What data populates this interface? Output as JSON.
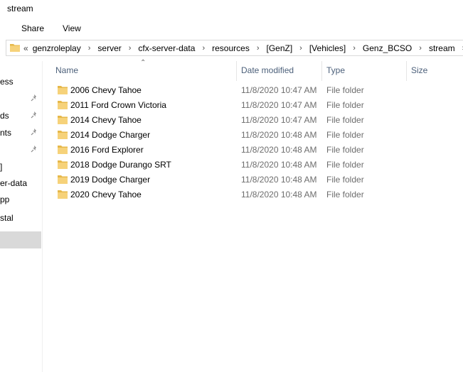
{
  "window": {
    "title": "stream"
  },
  "ribbon": {
    "tabs": [
      "Share",
      "View"
    ]
  },
  "address": {
    "overflow": "«",
    "crumbs": [
      "genzroleplay",
      "server",
      "cfx-server-data",
      "resources",
      "[GenZ]",
      "[Vehicles]",
      "Genz_BCSO",
      "stream"
    ]
  },
  "nav": {
    "items": [
      "ess",
      "ds",
      "nts",
      "]",
      "er-data",
      "pp",
      "stal"
    ]
  },
  "columns": {
    "name": "Name",
    "date": "Date modified",
    "type": "Type",
    "size": "Size"
  },
  "files": [
    {
      "name": "2006 Chevy Tahoe",
      "date": "11/8/2020 10:47 AM",
      "type": "File folder"
    },
    {
      "name": "2011 Ford Crown Victoria",
      "date": "11/8/2020 10:47 AM",
      "type": "File folder"
    },
    {
      "name": "2014 Chevy Tahoe",
      "date": "11/8/2020 10:47 AM",
      "type": "File folder"
    },
    {
      "name": "2014 Dodge Charger",
      "date": "11/8/2020 10:48 AM",
      "type": "File folder"
    },
    {
      "name": "2016 Ford Explorer",
      "date": "11/8/2020 10:48 AM",
      "type": "File folder"
    },
    {
      "name": "2018 Dodge Durango SRT",
      "date": "11/8/2020 10:48 AM",
      "type": "File folder"
    },
    {
      "name": "2019 Dodge Charger",
      "date": "11/8/2020 10:48 AM",
      "type": "File folder"
    },
    {
      "name": "2020 Chevy Tahoe",
      "date": "11/8/2020 10:48 AM",
      "type": "File folder"
    }
  ],
  "colors": {
    "folder": "#f0c75e",
    "header_text": "#4c607a",
    "selected_nav": "#d9d9d9"
  }
}
